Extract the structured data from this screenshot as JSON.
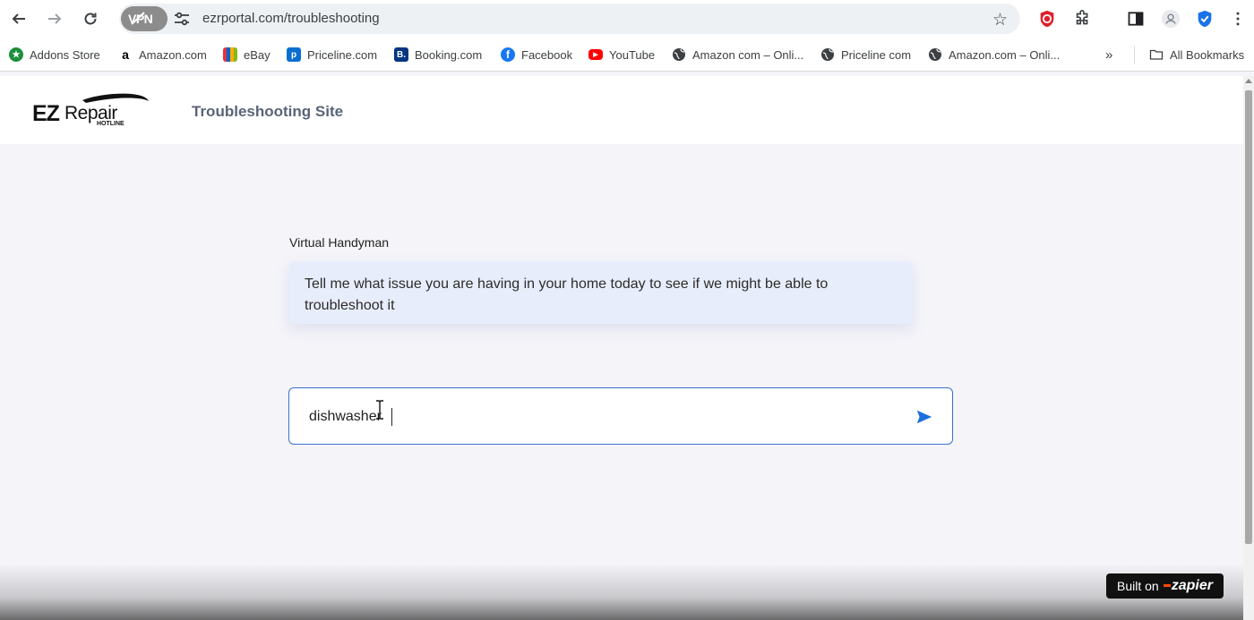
{
  "browser": {
    "url": "ezrportal.com/troubleshooting",
    "vpn_label": "VPN",
    "bookmarks": [
      {
        "label": "Addons Store",
        "icon": "addons-store-icon",
        "color": "#1e8e3e"
      },
      {
        "label": "Amazon.com",
        "icon": "amazon-icon",
        "color": "#000000"
      },
      {
        "label": "eBay",
        "icon": "ebay-icon",
        "color": "#e53238"
      },
      {
        "label": "Priceline.com",
        "icon": "priceline-icon",
        "color": "#0a6ed1"
      },
      {
        "label": "Booking.com",
        "icon": "booking-icon",
        "color": "#003580"
      },
      {
        "label": "Facebook",
        "icon": "facebook-icon",
        "color": "#1877f2"
      },
      {
        "label": "YouTube",
        "icon": "youtube-icon",
        "color": "#ff0000"
      },
      {
        "label": "Amazon com – Onli...",
        "icon": "globe-icon",
        "color": "#3c4043"
      },
      {
        "label": "Priceline com",
        "icon": "globe-icon",
        "color": "#3c4043"
      },
      {
        "label": "Amazon.com – Onli...",
        "icon": "globe-icon",
        "color": "#3c4043"
      }
    ],
    "all_bookmarks_label": "All Bookmarks"
  },
  "site": {
    "logo_text": "EZRepair",
    "logo_subtext": "HOTLINE",
    "title": "Troubleshooting Site"
  },
  "chat": {
    "bot_name": "Virtual Handyman",
    "bot_message": "Tell me what issue you are having in your home today to see if we might be able to troubleshoot it",
    "input_value": "dishwasher",
    "accent_color": "#1a6fe0"
  },
  "badge": {
    "built_on": "Built on",
    "brand": "zapier"
  }
}
